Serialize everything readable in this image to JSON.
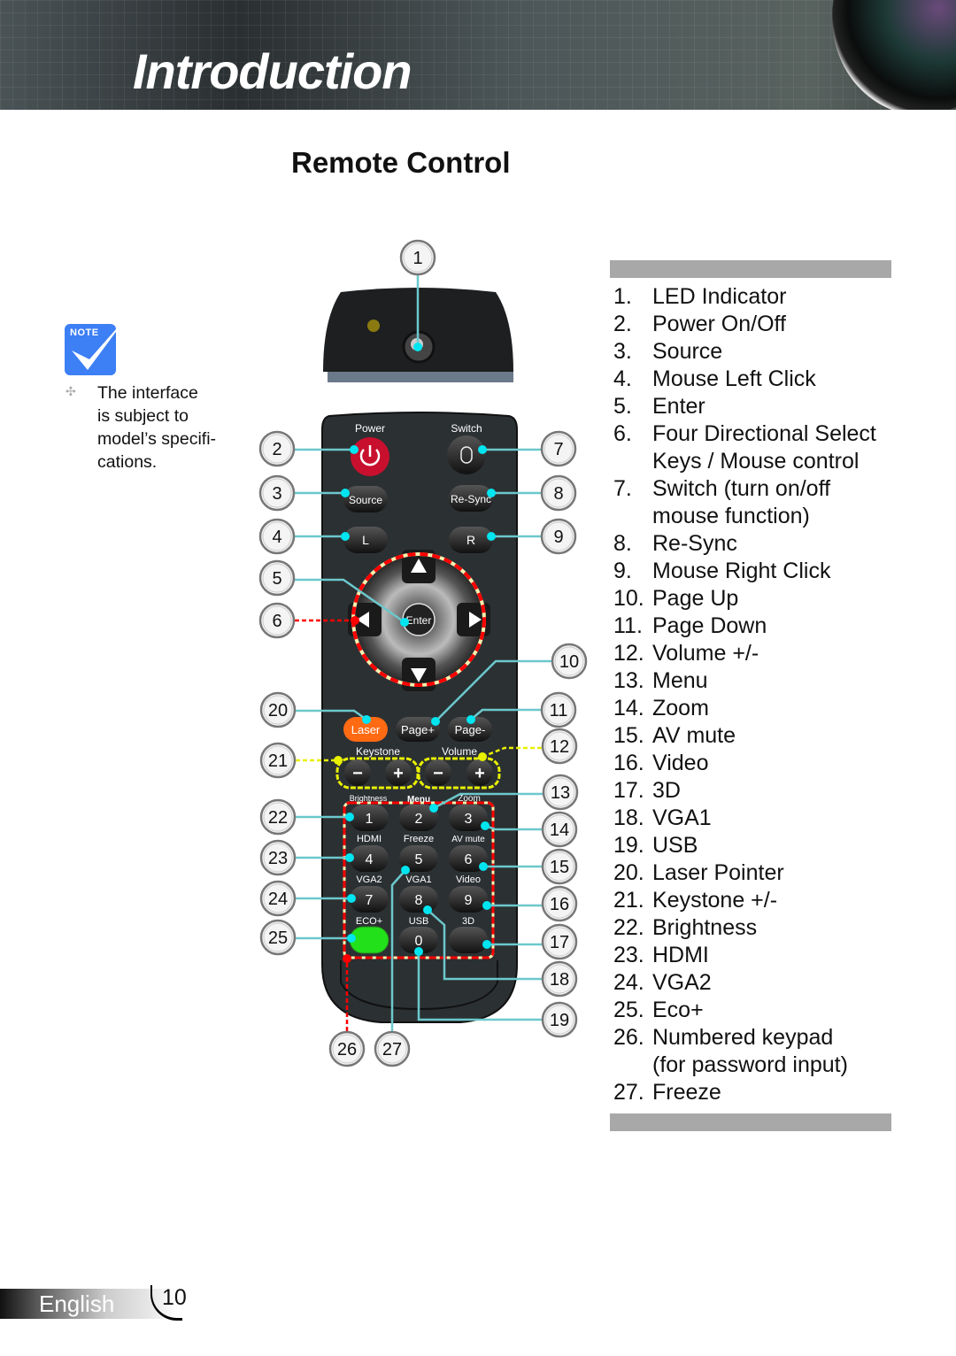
{
  "header": {
    "title": "Introduction"
  },
  "section_title": "Remote Control",
  "note": {
    "badge": "Note",
    "text": "The interface is subject to model’s specifications.",
    "lines": [
      "The interface",
      "is subject to",
      "model’s specifi-",
      "cations."
    ]
  },
  "remote": {
    "labels": [
      "Power",
      "Switch",
      "Keystone",
      "Volume",
      "Brightness",
      "Menu",
      "Zoom",
      "HDMI",
      "Freeze",
      "AV mute",
      "VGA2",
      "VGA1",
      "Video",
      "ECO+",
      "USB",
      "3D"
    ],
    "buttons": [
      "Source",
      "Re-Sync",
      "L",
      "R",
      "Enter",
      "Laser",
      "Page+",
      "Page-",
      "−",
      "+",
      "−",
      "+",
      "1",
      "2",
      "3",
      "4",
      "5",
      "6",
      "7",
      "8",
      "9",
      "0"
    ],
    "colors": {
      "power": "#c8102e",
      "laser": "#ff6a13",
      "eco": "#22e01a",
      "callout_line": "#6cc8cc",
      "dot": "#00e5f0",
      "highlight_red": "#ff0000",
      "highlight_yellow": "#e8f000"
    }
  },
  "callouts": [
    "1",
    "2",
    "3",
    "4",
    "5",
    "6",
    "7",
    "8",
    "9",
    "10",
    "11",
    "12",
    "13",
    "14",
    "15",
    "16",
    "17",
    "18",
    "19",
    "20",
    "21",
    "22",
    "23",
    "24",
    "25",
    "26",
    "27"
  ],
  "list": [
    {
      "n": "1.",
      "t": [
        "LED Indicator"
      ]
    },
    {
      "n": "2.",
      "t": [
        "Power On/Off"
      ]
    },
    {
      "n": "3.",
      "t": [
        "Source"
      ]
    },
    {
      "n": "4.",
      "t": [
        "Mouse Left Click"
      ]
    },
    {
      "n": "5.",
      "t": [
        "Enter"
      ]
    },
    {
      "n": "6.",
      "t": [
        "Four Directional Select",
        "Keys / Mouse control"
      ]
    },
    {
      "n": "7.",
      "t": [
        "Switch (turn on/off",
        "mouse function)"
      ]
    },
    {
      "n": "8.",
      "t": [
        "Re-Sync"
      ]
    },
    {
      "n": "9.",
      "t": [
        "Mouse Right Click"
      ]
    },
    {
      "n": "10.",
      "t": [
        "Page Up"
      ]
    },
    {
      "n": "11.",
      "t": [
        "Page Down"
      ]
    },
    {
      "n": "12.",
      "t": [
        "Volume +/-"
      ]
    },
    {
      "n": "13.",
      "t": [
        "Menu"
      ]
    },
    {
      "n": "14.",
      "t": [
        "Zoom"
      ]
    },
    {
      "n": "15.",
      "t": [
        "AV mute"
      ]
    },
    {
      "n": "16.",
      "t": [
        "Video"
      ]
    },
    {
      "n": "17.",
      "t": [
        "3D"
      ]
    },
    {
      "n": "18.",
      "t": [
        "VGA1"
      ]
    },
    {
      "n": "19.",
      "t": [
        "USB"
      ]
    },
    {
      "n": "20.",
      "t": [
        "Laser Pointer"
      ]
    },
    {
      "n": "21.",
      "t": [
        "Keystone +/-"
      ]
    },
    {
      "n": "22.",
      "t": [
        "Brightness"
      ]
    },
    {
      "n": "23.",
      "t": [
        "HDMI"
      ]
    },
    {
      "n": "24.",
      "t": [
        "VGA2"
      ]
    },
    {
      "n": "25.",
      "t": [
        "Eco+"
      ]
    },
    {
      "n": "26.",
      "t": [
        "Numbered keypad",
        "(for password input)"
      ]
    },
    {
      "n": "27.",
      "t": [
        "Freeze"
      ]
    }
  ],
  "footer": {
    "language": "English",
    "page": "10"
  }
}
